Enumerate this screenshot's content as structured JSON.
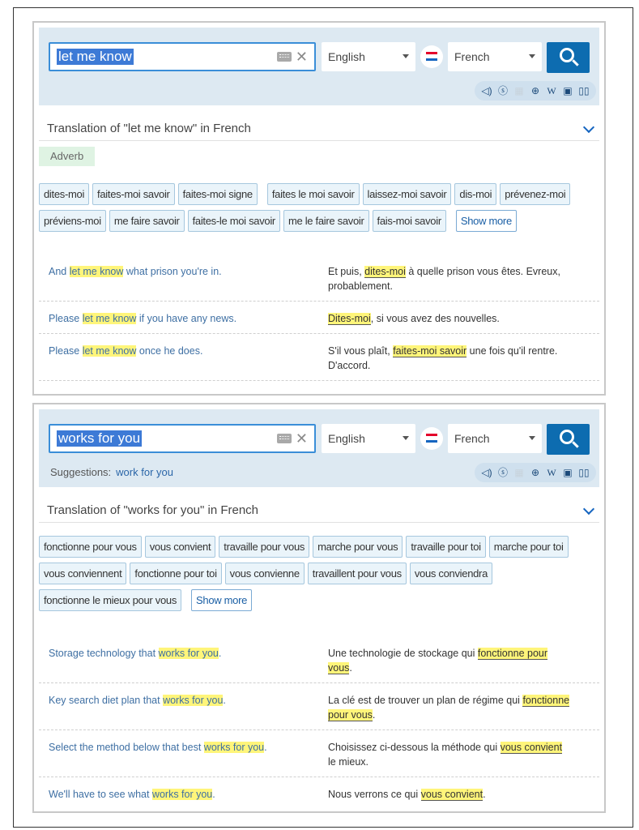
{
  "panel1": {
    "search": {
      "value": "let me know"
    },
    "source_lang": "English",
    "target_lang": "French",
    "title": "Translation of \"let me know\" in French",
    "pos": "Adverb",
    "chips": [
      "dites-moi",
      "faites-moi savoir",
      "faites-moi signe",
      "faites le moi savoir",
      "laissez-moi savoir",
      "dis-moi",
      "prévenez-moi",
      "préviens-moi",
      "me faire savoir",
      "faites-le moi savoir",
      "me le faire savoir",
      "fais-moi savoir"
    ],
    "show_more": "Show more",
    "examples": [
      {
        "src_pre": "And ",
        "src_hl": "let me know",
        "src_post": " what prison you're in.",
        "tgt_pre": "Et puis, ",
        "tgt_hl": "dites-moi",
        "tgt_post": " à quelle prison vous êtes. Evreux, probablement."
      },
      {
        "src_pre": "Please ",
        "src_hl": "let me know",
        "src_post": " if you have any news.",
        "tgt_pre": "",
        "tgt_hl": "Dites-moi",
        "tgt_post": ", si vous avez des nouvelles."
      },
      {
        "src_pre": "Please ",
        "src_hl": "let me know",
        "src_post": " once he does.",
        "tgt_pre": "S'il vous plaît, ",
        "tgt_hl": "faites-moi savoir",
        "tgt_post": " une fois qu'il rentre. D'accord."
      }
    ]
  },
  "panel2": {
    "search": {
      "value": "works for you"
    },
    "source_lang": "English",
    "target_lang": "French",
    "suggestions_label": "Suggestions:",
    "suggestion": "work for you",
    "title": "Translation of \"works for you\" in French",
    "chips": [
      "fonctionne pour vous",
      "vous convient",
      "travaille pour vous",
      "marche pour vous",
      "travaille pour toi",
      "marche pour toi",
      "vous conviennent",
      "fonctionne pour toi",
      "vous convienne",
      "travaillent pour vous",
      "vous conviendra",
      "fonctionne le mieux pour vous"
    ],
    "show_more": "Show more",
    "examples": [
      {
        "src_pre": "Storage technology that ",
        "src_hl": "works for you",
        "src_post": ".",
        "tgt_pre": "Une technologie de stockage qui ",
        "tgt_hl": "fonctionne pour vous",
        "tgt_post": "."
      },
      {
        "src_pre": "Key search diet plan that ",
        "src_hl": "works for you",
        "src_post": ".",
        "tgt_pre": "La clé est de trouver un plan de régime qui ",
        "tgt_hl": "fonctionne pour vous",
        "tgt_post": "."
      },
      {
        "src_pre": "Select the method below that best ",
        "src_hl": "works for you",
        "src_post": ".",
        "tgt_pre": "Choisissez ci-dessous la méthode qui ",
        "tgt_hl": "vous convient",
        "tgt_post": " le mieux."
      },
      {
        "src_pre": "We'll have to see what ",
        "src_hl": "works for you",
        "src_post": ".",
        "tgt_pre": "Nous verrons ce qui ",
        "tgt_hl": "vous convient",
        "tgt_post": "."
      }
    ]
  },
  "toolbar_icons": [
    "speaker-icon",
    "skype-icon",
    "grid-icon",
    "globe-icon",
    "wikipedia-icon",
    "image-icon",
    "book-icon"
  ],
  "colors": {
    "accent": "#0d6cb0",
    "bar": "#dde9f2",
    "chip_bg": "#eaf4fa",
    "highlight": "#fff57a"
  }
}
